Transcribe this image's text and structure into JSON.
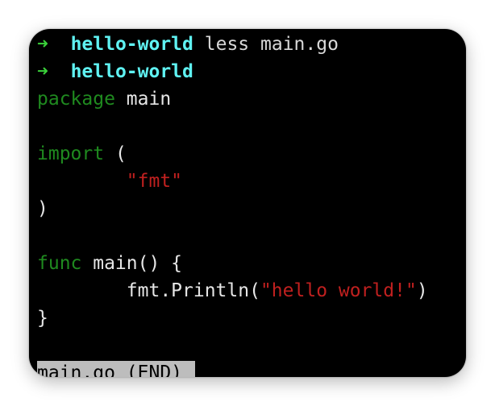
{
  "prompt1": {
    "arrow": "➜",
    "dir": "hello-world",
    "command": "less main.go"
  },
  "prompt2": {
    "arrow": "➜",
    "dir": "hello-world"
  },
  "code": {
    "l1_kw": "package",
    "l1_rest": " main",
    "l3_kw": "import",
    "l3_rest": " (",
    "l4_indent": "        ",
    "l4_str": "\"fmt\"",
    "l5": ")",
    "l7_kw": "func",
    "l7_rest": " main() {",
    "l8_indent": "        ",
    "l8_pre": "fmt.Println(",
    "l8_str": "\"hello world!\"",
    "l8_post": ")",
    "l9": "}"
  },
  "pager": {
    "status": "main.go (END)"
  }
}
